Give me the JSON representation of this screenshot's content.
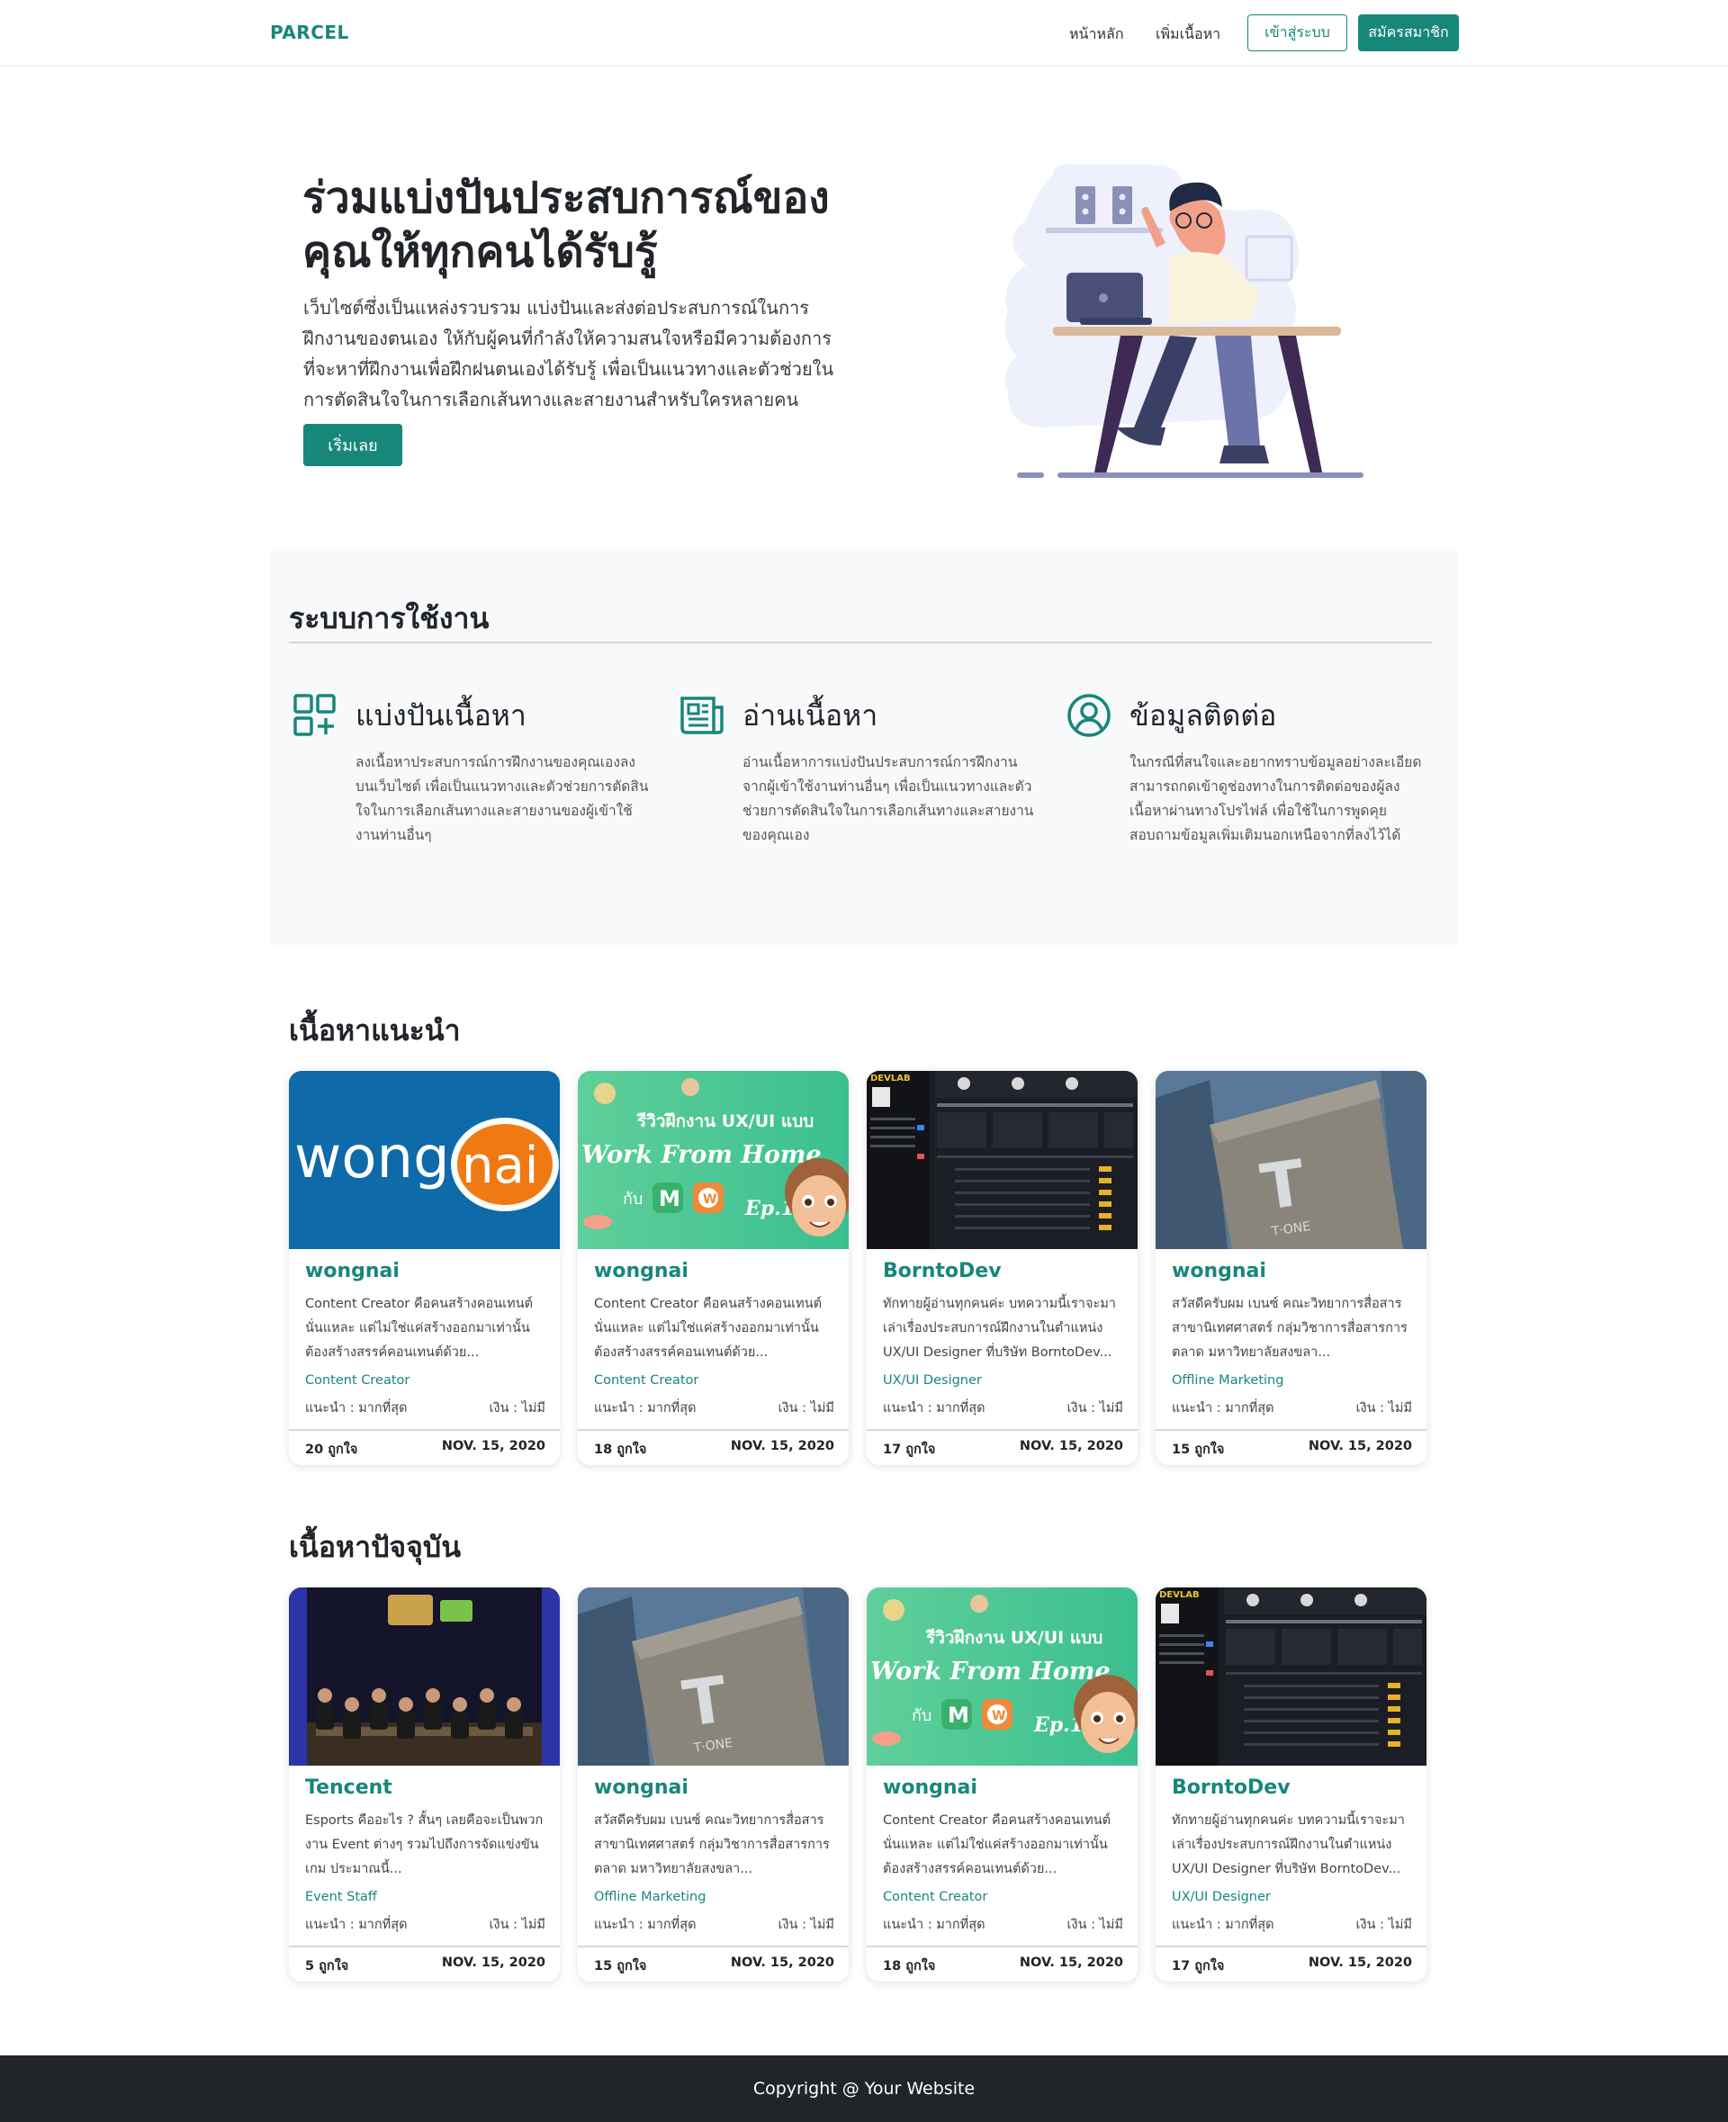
{
  "nav": {
    "brand": "PARCEL",
    "links": [
      "หน้าหลัก",
      "เพิ่มเนื้อหา"
    ],
    "login": "เข้าสู่ระบบ",
    "register": "สมัครสมาชิก"
  },
  "hero": {
    "title_line1": "ร่วมแบ่งปันประสบการณ์ของ",
    "title_line2": "คุณให้ทุกคนได้รับรู้",
    "description": "เว็บไซต์ซึ่งเป็นแหล่งรวบรวม แบ่งปันและส่งต่อประสบการณ์ในการฝึกงานของตนเอง ให้กับผู้คนที่กำลังให้ความสนใจหรือมีความต้องการที่จะหาที่ฝึกงานเพื่อฝึกฝนตนเองได้รับรู้ เพื่อเป็นแนวทางและตัวช่วยในการตัดสินใจในการเลือกเส้นทางและสายงานสำหรับใครหลายคน",
    "cta": "เริ่มเลย"
  },
  "features": {
    "title": "ระบบการใช้งาน",
    "items": [
      {
        "icon": "apps-add-icon",
        "title": "แบ่งปันเนื้อหา",
        "desc": "ลงเนื้อหาประสบการณ์การฝึกงานของคุณเองลงบนเว็บไซต์ เพื่อเป็นแนวทางและตัวช่วยการตัดสินใจในการเลือกเส้นทางและสายงานของผู้เข้าใช้งานท่านอื่นๆ"
      },
      {
        "icon": "newspaper-icon",
        "title": "อ่านเนื้อหา",
        "desc": "อ่านเนื้อหาการแบ่งปันประสบการณ์การฝึกงานจากผู้เข้าใช้งานท่านอื่นๆ เพื่อเป็นแนวทางและตัวช่วยการตัดสินใจในการเลือกเส้นทางและสายงานของคุณเอง"
      },
      {
        "icon": "user-circle-icon",
        "title": "ข้อมูลติดต่อ",
        "desc": "ในกรณีที่สนใจและอยากทราบข้อมูลอย่างละเอียด สามารถกดเข้าดูช่องทางในการติดต่อของผู้ลงเนื้อหาผ่านทางโปรไฟล์ เพื่อใช้ในการพูดคุยสอบถามข้อมูลเพิ่มเติมนอกเหนือจากที่ลงไว้ได้"
      }
    ]
  },
  "recommended": {
    "title": "เนื้อหาแนะนำ",
    "cards": [
      {
        "thumb": "wongnai-logo",
        "company": "wongnai",
        "desc": "Content Creator คือคนสร้างคอนเทนต์นั่นแหละ แต่ไม่ใช่แค่สร้างออกมาเท่านั้น ต้องสร้างสรรค์คอนเทนต์ด้วย...",
        "tag": "Content Creator",
        "rec": "แนะนำ : มากที่สุด",
        "money": "เงิน : ไม่มี",
        "likes": "20 ถูกใจ",
        "date": "NOV. 15, 2020"
      },
      {
        "thumb": "wfh-banner",
        "company": "wongnai",
        "desc": "Content Creator คือคนสร้างคอนเทนต์นั่นแหละ แต่ไม่ใช่แค่สร้างออกมาเท่านั้น ต้องสร้างสรรค์คอนเทนต์ด้วย...",
        "tag": "Content Creator",
        "rec": "แนะนำ : มากที่สุด",
        "money": "เงิน : ไม่มี",
        "likes": "18 ถูกใจ",
        "date": "NOV. 15, 2020"
      },
      {
        "thumb": "devlab-screen",
        "company": "BorntoDev",
        "desc": "ทักทายผู้อ่านทุกคนค่ะ บทความนี้เราจะมาเล่าเรื่องประสบการณ์ฝึกงานในตำแหน่ง UX/UI Designer ที่บริษัท BorntoDev...",
        "tag": "UX/UI Designer",
        "rec": "แนะนำ : มากที่สุด",
        "money": "เงิน : ไม่มี",
        "likes": "17 ถูกใจ",
        "date": "NOV. 15, 2020"
      },
      {
        "thumb": "tone-building",
        "company": "wongnai",
        "desc": "สวัสดีครับผม เบนซ์ คณะวิทยาการสื่อสาร สาขานิเทศศาสตร์ กลุ่มวิชาการสื่อสารการตลาด มหาวิทยาลัยสงขลา...",
        "tag": "Offline Marketing",
        "rec": "แนะนำ : มากที่สุด",
        "money": "เงิน : ไม่มี",
        "likes": "15 ถูกใจ",
        "date": "NOV. 15, 2020"
      }
    ]
  },
  "current": {
    "title": "เนื้อหาปัจจุบัน",
    "cards": [
      {
        "thumb": "esports-stage",
        "company": "Tencent",
        "desc": "Esports คืออะไร ? สั้นๆ เลยคือจะเป็นพวกงาน Event ต่างๆ รวมไปถึงการจัดแข่งขันเกม ประมาณนี้...",
        "tag": "Event Staff",
        "rec": "แนะนำ : มากที่สุด",
        "money": "เงิน : ไม่มี",
        "likes": "5 ถูกใจ",
        "date": "NOV. 15, 2020"
      },
      {
        "thumb": "tone-building",
        "company": "wongnai",
        "desc": "สวัสดีครับผม เบนซ์ คณะวิทยาการสื่อสาร สาขานิเทศศาสตร์ กลุ่มวิชาการสื่อสารการตลาด มหาวิทยาลัยสงขลา...",
        "tag": "Offline Marketing",
        "rec": "แนะนำ : มากที่สุด",
        "money": "เงิน : ไม่มี",
        "likes": "15 ถูกใจ",
        "date": "NOV. 15, 2020"
      },
      {
        "thumb": "wfh-banner",
        "company": "wongnai",
        "desc": "Content Creator คือคนสร้างคอนเทนต์นั่นแหละ แต่ไม่ใช่แค่สร้างออกมาเท่านั้น ต้องสร้างสรรค์คอนเทนต์ด้วย...",
        "tag": "Content Creator",
        "rec": "แนะนำ : มากที่สุด",
        "money": "เงิน : ไม่มี",
        "likes": "18 ถูกใจ",
        "date": "NOV. 15, 2020"
      },
      {
        "thumb": "devlab-screen",
        "company": "BorntoDev",
        "desc": "ทักทายผู้อ่านทุกคนค่ะ บทความนี้เราจะมาเล่าเรื่องประสบการณ์ฝึกงานในตำแหน่ง UX/UI Designer ที่บริษัท BorntoDev...",
        "tag": "UX/UI Designer",
        "rec": "แนะนำ : มากที่สุด",
        "money": "เงิน : ไม่มี",
        "likes": "17 ถูกใจ",
        "date": "NOV. 15, 2020"
      }
    ]
  },
  "thumb_text": {
    "wongnai_left": "wong",
    "wongnai_right": "nai",
    "wfh_line1": "รีวิวฝึกงาน UX/UI แบบ",
    "wfh_line2": "Work From Home",
    "wfh_with": "กับ",
    "wfh_ep": "Ep.1",
    "devlab": "DEVLAB",
    "tone_letter": "T",
    "tone_word": "T·ONE"
  },
  "footer": {
    "text": "Copyright @ Your Website"
  },
  "colors": {
    "primary": "#17877a",
    "dark": "#212529",
    "feature_bg": "#f8f9fa"
  }
}
